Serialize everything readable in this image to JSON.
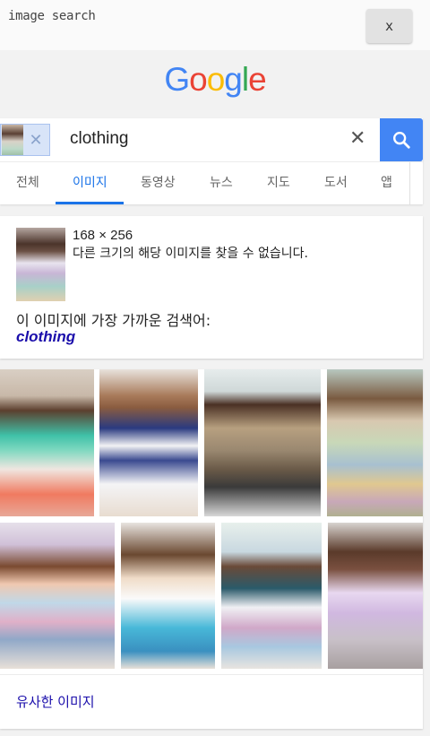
{
  "app": {
    "title": "image search",
    "close_label": "x"
  },
  "logo": {
    "letters": [
      "G",
      "o",
      "o",
      "g",
      "l",
      "e"
    ],
    "colors": [
      "#4285f4",
      "#ea4335",
      "#fbbc05",
      "#4285f4",
      "#34a853",
      "#ea4335"
    ]
  },
  "search": {
    "query": "clothing",
    "clear_icon": "close-icon",
    "button_icon": "search-icon",
    "accent": "#4285f4"
  },
  "tabs": [
    {
      "label": "전체",
      "active": false
    },
    {
      "label": "이미지",
      "active": true
    },
    {
      "label": "동영상",
      "active": false
    },
    {
      "label": "뉴스",
      "active": false
    },
    {
      "label": "지도",
      "active": false
    },
    {
      "label": "도서",
      "active": false
    },
    {
      "label": "앱",
      "active": false
    }
  ],
  "info": {
    "dimensions": "168 × 256",
    "not_found": "다른 크기의 해당 이미지를 찾을 수 없습니다.",
    "best_guess_label": "이 이미지에 가장 가까운 검색어:",
    "best_guess": "clothing"
  },
  "results": {
    "similar_link": "유사한 이미지"
  }
}
